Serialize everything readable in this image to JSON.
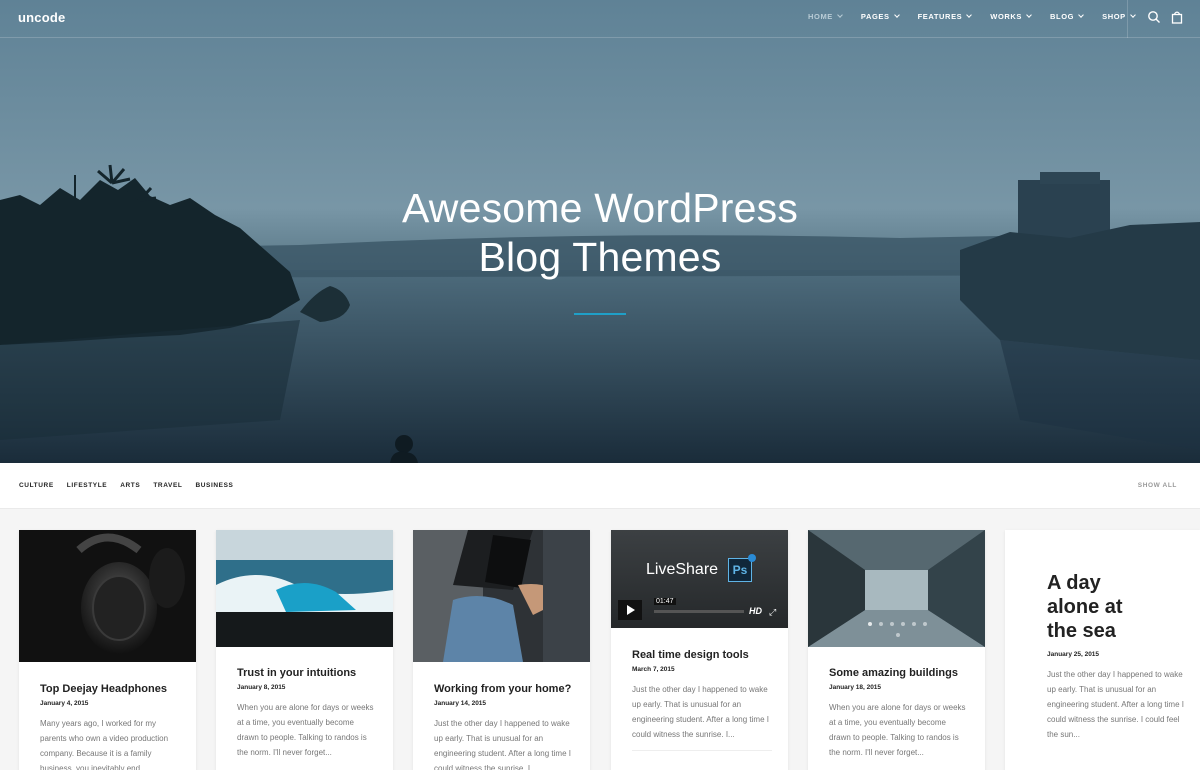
{
  "brand": {
    "logo": "uncode",
    "accent": "#1fa0c8"
  },
  "nav": {
    "items": [
      {
        "label": "HOME",
        "active": true
      },
      {
        "label": "PAGES"
      },
      {
        "label": "FEATURES"
      },
      {
        "label": "WORKS"
      },
      {
        "label": "BLOG"
      },
      {
        "label": "SHOP"
      }
    ],
    "icons": [
      "search-icon",
      "shopping-bag-icon"
    ]
  },
  "hero": {
    "title_line1": "Awesome WordPress",
    "title_line2": "Blog Themes"
  },
  "filters": {
    "items": [
      "CULTURE",
      "LIFESTYLE",
      "ARTS",
      "TRAVEL",
      "BUSINESS"
    ],
    "show_all": "SHOW ALL"
  },
  "cards": [
    {
      "title": "Top Deejay Headphones",
      "date": "January 4, 2015",
      "text": "Many years ago, I worked for my parents who own a video production company. Because it is a family business, you inevitably end"
    },
    {
      "title": "Trust in your intuitions",
      "date": "January 8, 2015",
      "text": "When you are alone for days or weeks at a time, you eventually become drawn to people. Talking to randos is the norm. I'll never forget..."
    },
    {
      "title": "Working from your home?",
      "date": "January 14, 2015",
      "text": "Just the other day I happened to wake up early. That is unusual for an engineering student. After a long time I could witness the sunrise. I..."
    },
    {
      "title": "Real time design tools",
      "date": "March 7, 2015",
      "text": "Just the other day I happened to wake up early. That is unusual for an engineering student. After a long time I could witness the sunrise. I...",
      "video": {
        "brand": "LiveShare",
        "badge": "Ps",
        "time": "01:47",
        "hd": "HD"
      }
    },
    {
      "title": "Some amazing buildings",
      "date": "January 18, 2015",
      "text": "When you are alone for days or weeks at a time, you eventually become drawn to people. Talking to randos is the norm. I'll never forget..."
    },
    {
      "title_lines": [
        "A day",
        "alone at",
        "the sea"
      ],
      "date": "January 25, 2015",
      "text": "Just the other day I happened to wake up early. That is unusual for an engineering student. After a long time I could witness the sunrise. I could feel the sun..."
    }
  ]
}
